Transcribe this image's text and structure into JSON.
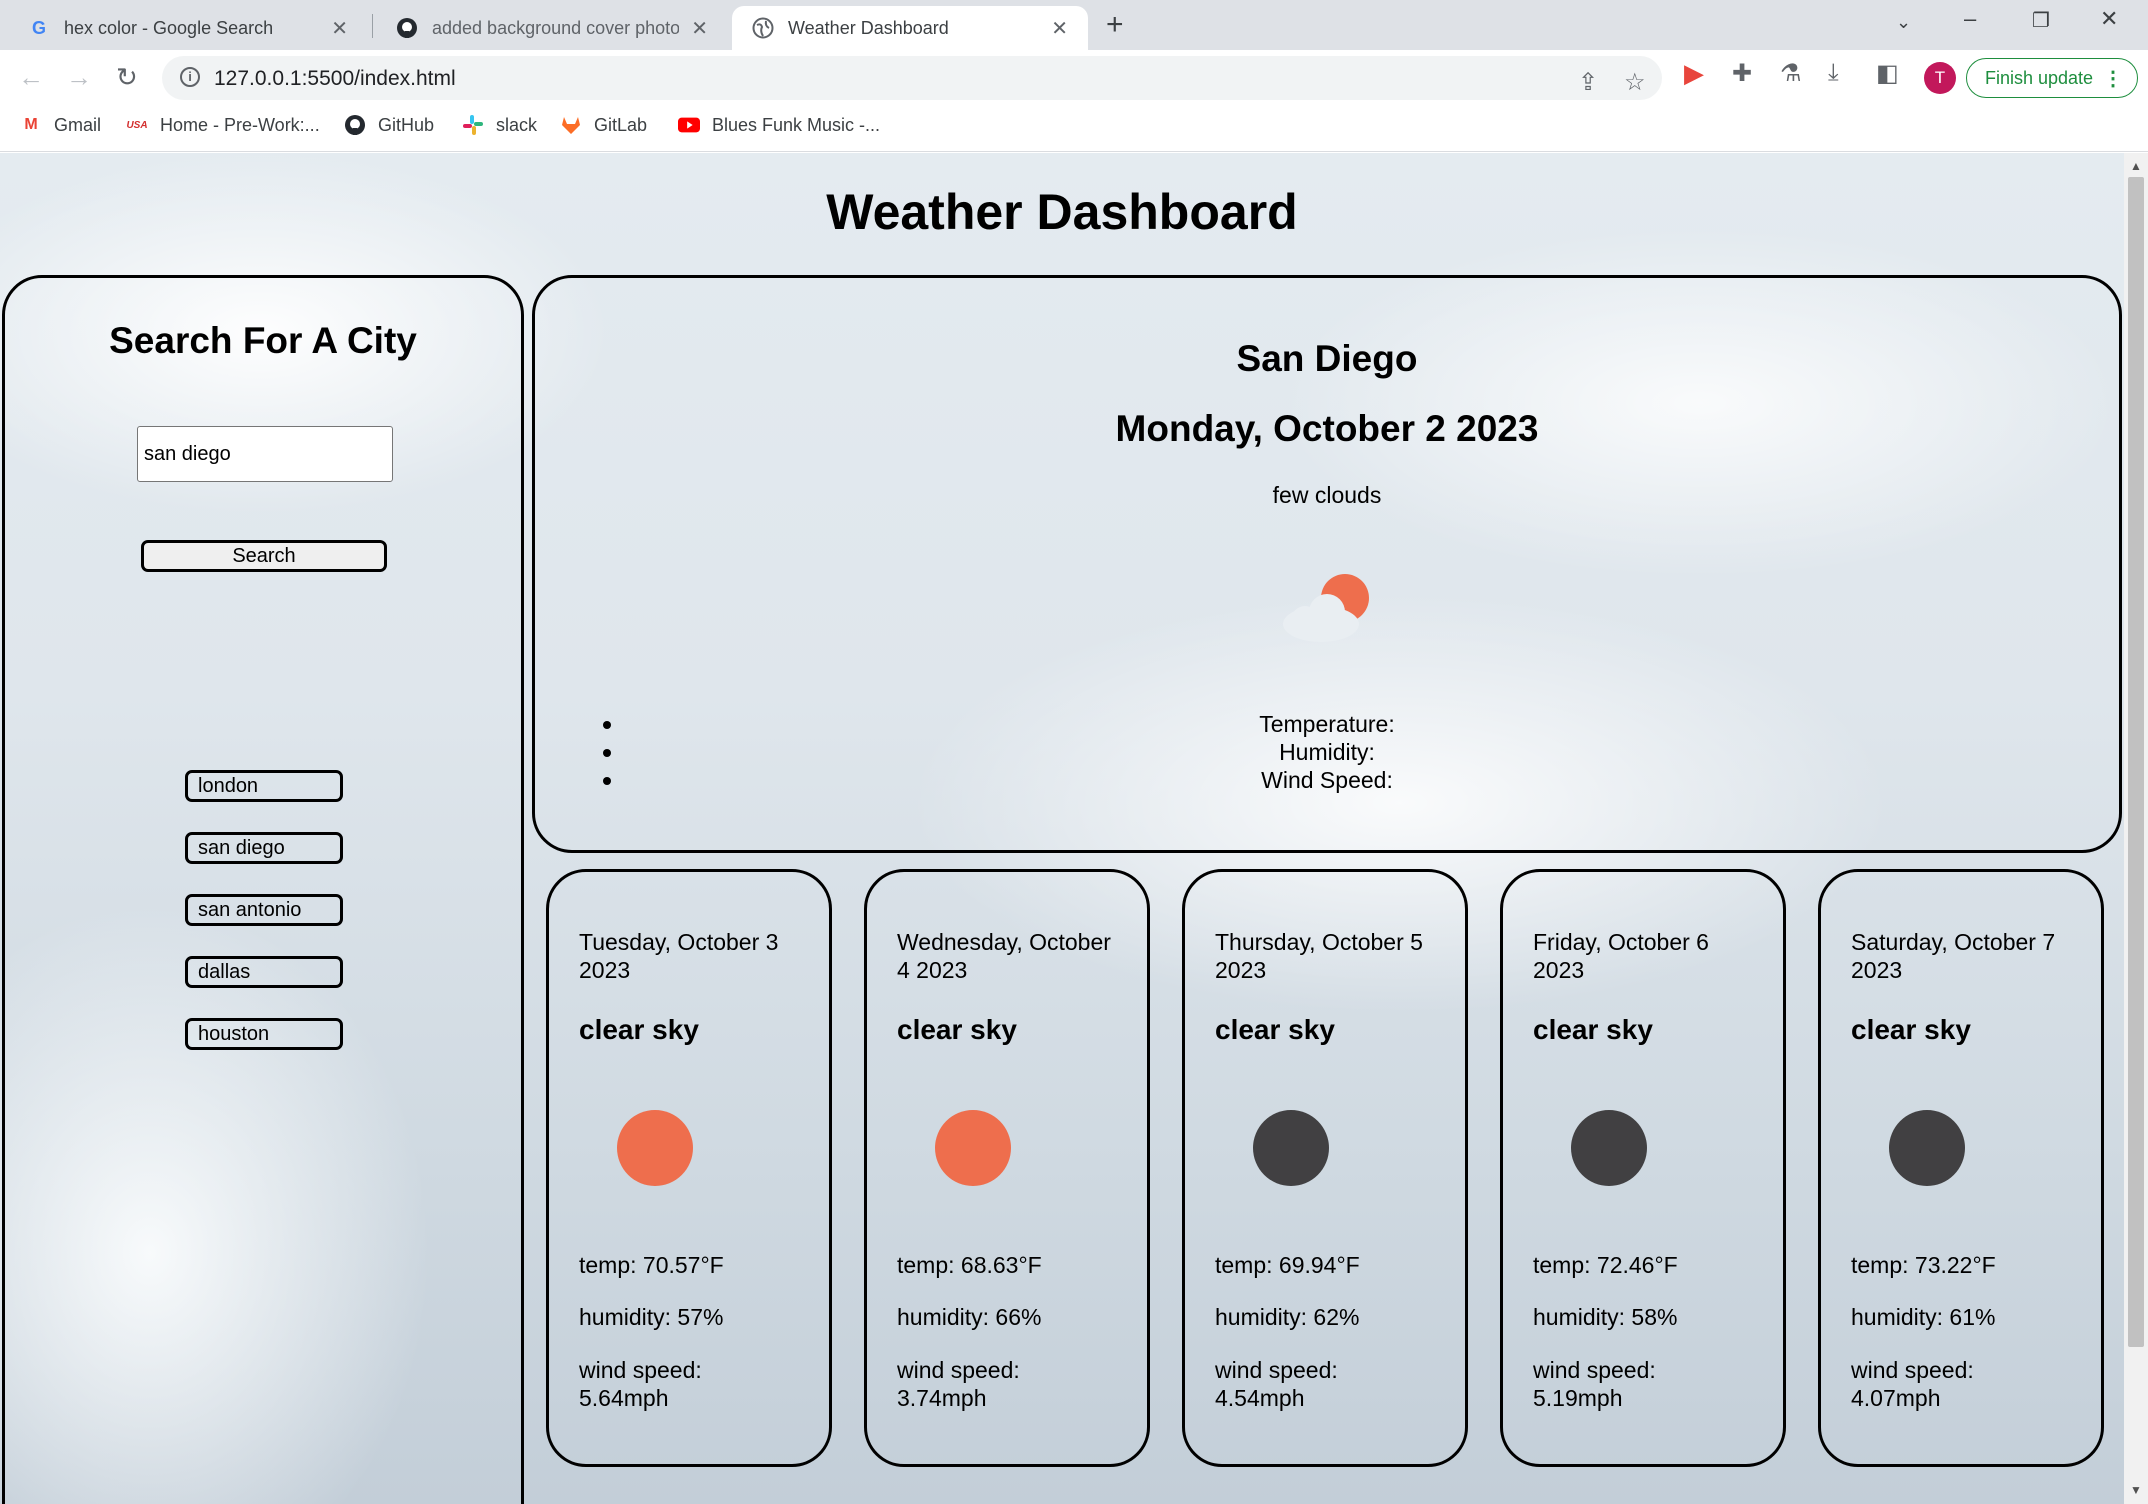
{
  "browser": {
    "tabs": [
      {
        "title": "hex color - Google Search",
        "favicon": "google-icon"
      },
      {
        "title": "added background cover photo",
        "favicon": "github-icon"
      },
      {
        "title": "Weather Dashboard",
        "favicon": "globe-icon"
      }
    ],
    "url": "127.0.0.1:5500/index.html",
    "finish_update": "Finish update",
    "avatar_letter": "T",
    "bookmarks": [
      {
        "label": "Gmail",
        "icon": "gmail-icon"
      },
      {
        "label": "Home - Pre-Work:...",
        "icon": "usa-icon"
      },
      {
        "label": "GitHub",
        "icon": "github-icon"
      },
      {
        "label": "slack",
        "icon": "slack-icon"
      },
      {
        "label": "GitLab",
        "icon": "gitlab-icon"
      },
      {
        "label": "Blues Funk Music -...",
        "icon": "youtube-icon"
      }
    ]
  },
  "page": {
    "title": "Weather Dashboard",
    "sidebar": {
      "heading": "Search For A City",
      "search_value": "san diego",
      "search_button": "Search",
      "history": [
        "london",
        "san diego",
        "san antonio",
        "dallas",
        "houston"
      ]
    },
    "current": {
      "city": "San Diego",
      "date": "Monday, October 2 2023",
      "description": "few clouds",
      "icon": "few-clouds-day-icon",
      "temperature_label": "Temperature:",
      "humidity_label": "Humidity:",
      "wind_label": "Wind Speed:"
    },
    "forecast": [
      {
        "date": "Tuesday, October 3 2023",
        "description": "clear sky",
        "icon": "sun-icon",
        "temp": "temp: 70.57°F",
        "humidity": "humidity: 57%",
        "wind": "wind speed: 5.64mph"
      },
      {
        "date": "Wednesday, October 4 2023",
        "description": "clear sky",
        "icon": "sun-icon",
        "temp": "temp: 68.63°F",
        "humidity": "humidity: 66%",
        "wind": "wind speed: 3.74mph"
      },
      {
        "date": "Thursday, October 5 2023",
        "description": "clear sky",
        "icon": "moon-icon",
        "temp": "temp: 69.94°F",
        "humidity": "humidity: 62%",
        "wind": "wind speed: 4.54mph"
      },
      {
        "date": "Friday, October 6 2023",
        "description": "clear sky",
        "icon": "moon-icon",
        "temp": "temp: 72.46°F",
        "humidity": "humidity: 58%",
        "wind": "wind speed: 5.19mph"
      },
      {
        "date": "Saturday, October 7 2023",
        "description": "clear sky",
        "icon": "moon-icon",
        "temp": "temp: 73.22°F",
        "humidity": "humidity: 61%",
        "wind": "wind speed: 4.07mph"
      }
    ]
  },
  "colors": {
    "sun": "#ee6e4d",
    "moon": "#414042",
    "update_green": "#1e8e3e"
  }
}
